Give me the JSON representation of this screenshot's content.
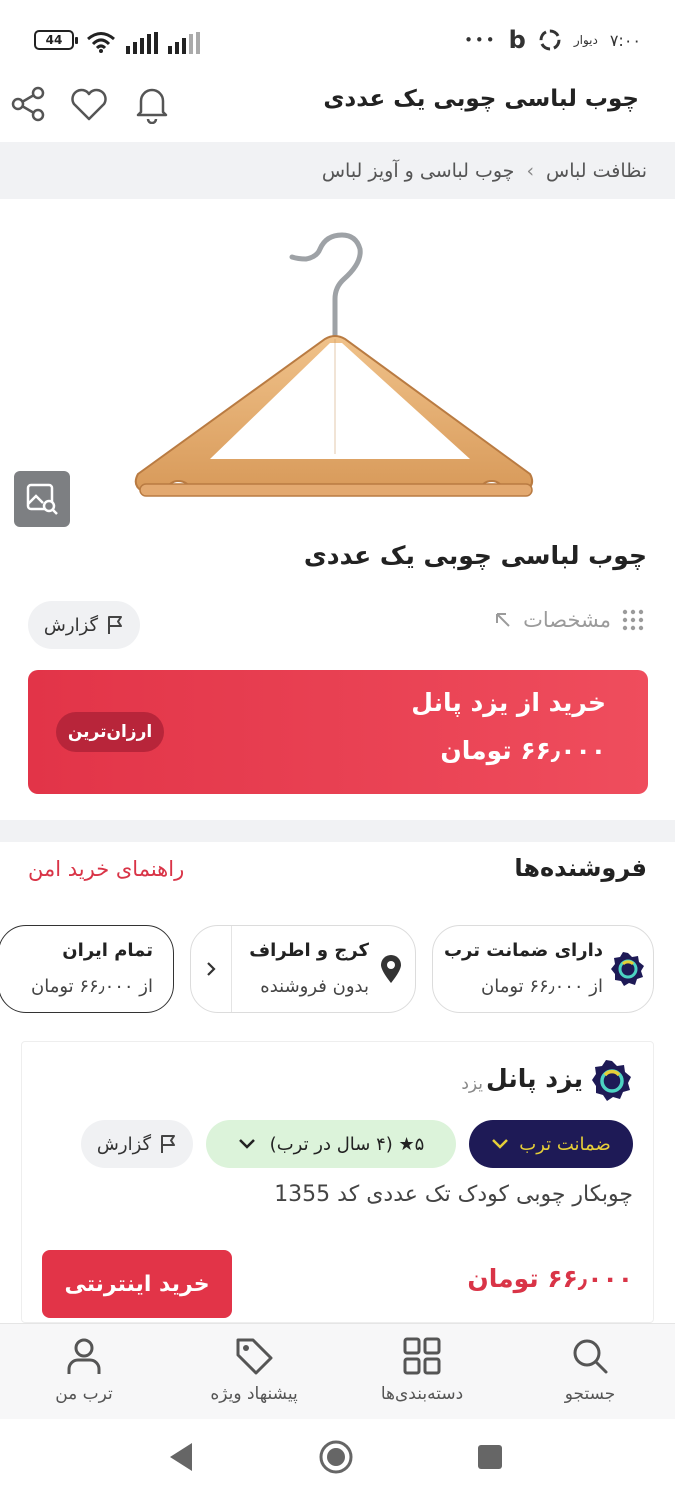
{
  "status_bar": {
    "battery": "44",
    "time": "۷:۰۰",
    "app_label": "دیوار",
    "dots": "•••"
  },
  "header": {
    "title": "چوب لباسی چوبی یک عددی"
  },
  "breadcrumb": {
    "items": [
      "نظافت لباس",
      "چوب لباسی و آویز لباس"
    ],
    "separator": "›"
  },
  "product": {
    "title": "چوب لباسی چوبی یک عددی",
    "specs_label": "مشخصات",
    "report_label": "گزارش"
  },
  "buy_banner": {
    "title": "خرید از یزد پانل",
    "price": "۶۶٫۰۰۰ تومان",
    "badge": "ارزان‌ترین"
  },
  "sellers": {
    "title": "فروشنده‌ها",
    "guide_link": "راهنمای خرید امن",
    "filters": [
      {
        "title": "دارای ضمانت ترب",
        "sub": "از ۶۶٫۰۰۰ تومان"
      },
      {
        "title": "کرج و اطراف",
        "sub": "بدون فروشنده"
      },
      {
        "title": "تمام ایران",
        "sub": "از ۶۶٫۰۰۰ تومان"
      }
    ]
  },
  "offer": {
    "shop_name": "یزد پانل",
    "shop_city": "یزد",
    "guarantee": "ضمانت ترب",
    "rating": "۵★ (۴ سال در ترب)",
    "report_label": "گزارش",
    "description": "چوبکار چوبی کودک تک عددی کد 1355",
    "price": "۶۶٫۰۰۰ تومان",
    "buy_label": "خرید اینترنتی"
  },
  "bottom_nav": {
    "items": [
      "جستجو",
      "دسته‌بندی‌ها",
      "پیشنهاد ویژه",
      "ترب من"
    ]
  },
  "colors": {
    "accent": "#e23448",
    "guarantee_bg": "#1e1a56",
    "guarantee_text": "#e6cf38",
    "rating_bg": "#dcf3da"
  }
}
